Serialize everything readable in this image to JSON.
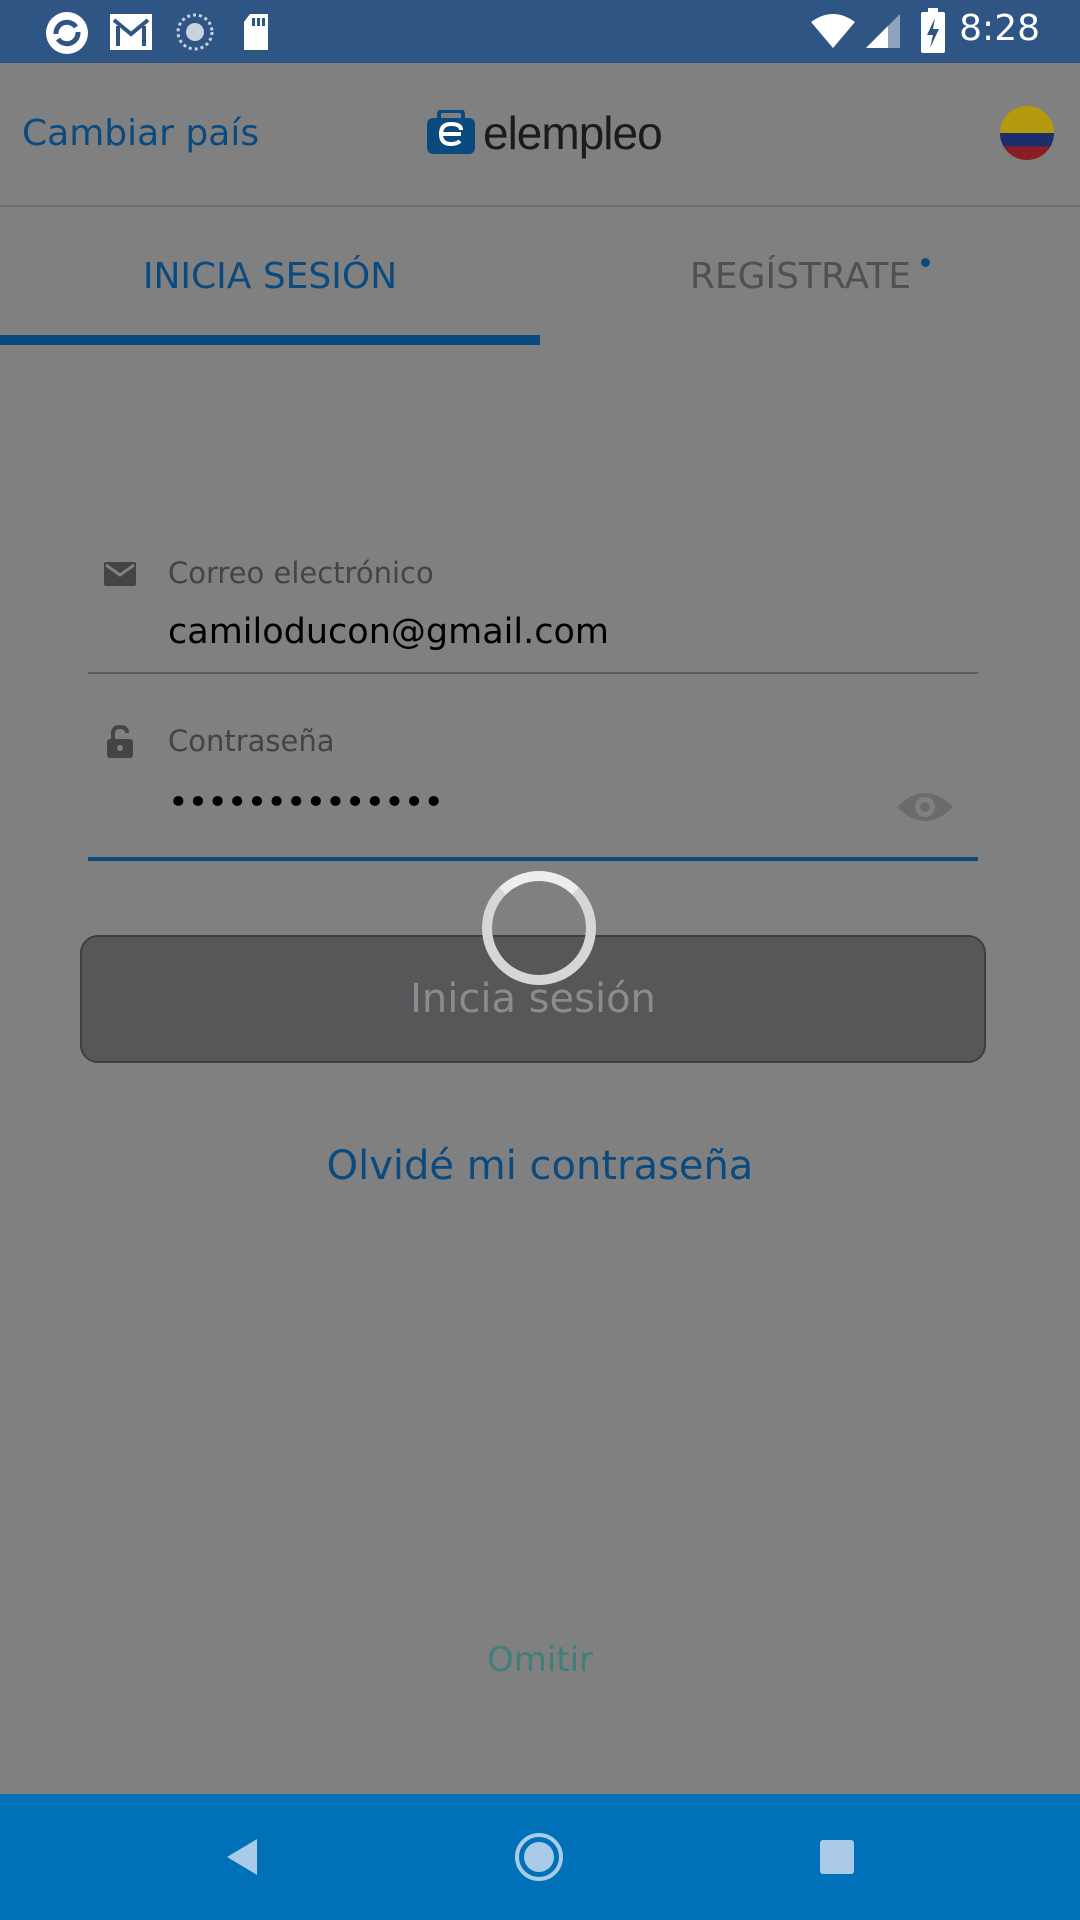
{
  "status_bar": {
    "time": "8:28",
    "left_icons": [
      "sync-icon",
      "gmail-icon",
      "loading-icon",
      "sd-card-icon"
    ],
    "right_icons": [
      "wifi-icon",
      "signal-icon",
      "battery-charging-icon"
    ]
  },
  "header": {
    "change_country": "Cambiar país",
    "logo_text": "elempleo",
    "country_flag": "colombia-flag"
  },
  "tabs": [
    {
      "label": "INICIA SESIÓN",
      "active": true
    },
    {
      "label": "REGÍSTRATE",
      "active": false
    }
  ],
  "form": {
    "email": {
      "label": "Correo electrónico",
      "value": "camiloducon@gmail.com",
      "icon": "envelope-icon"
    },
    "password": {
      "label": "Contraseña",
      "value": "••••••••••••••",
      "icon": "unlock-icon",
      "toggle_icon": "eye-icon"
    },
    "submit_label": "Inicia sesión",
    "loading": true
  },
  "forgot_password": "Olvidé mi contraseña",
  "skip": "Omitir",
  "nav": [
    "back",
    "home",
    "recents"
  ],
  "colors": {
    "status_bar": "#2f5584",
    "overlay": "#808080",
    "brand_blue": "#0a4a7f",
    "nav_bar": "#0070b8"
  }
}
